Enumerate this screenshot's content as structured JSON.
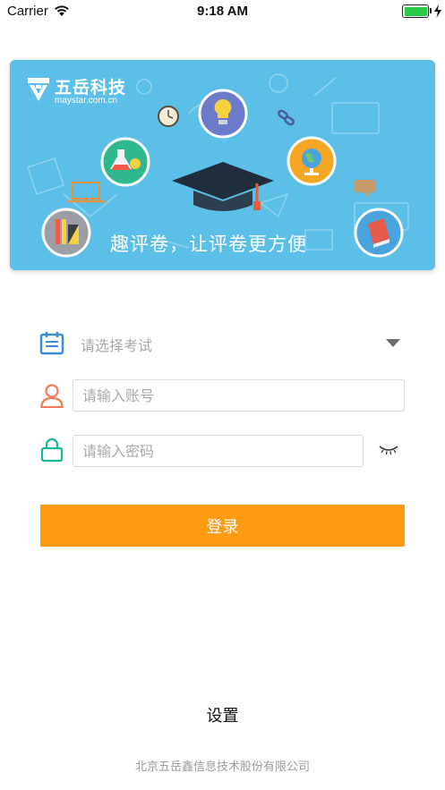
{
  "status_bar": {
    "carrier": "Carrier",
    "time": "9:18 AM",
    "battery_level": 1.0
  },
  "banner": {
    "logo_name": "五岳科技",
    "logo_url": "maystar.com.cn",
    "slogan": "趣评卷，让评卷更方便",
    "background_color": "#5bbfe8"
  },
  "form": {
    "exam_placeholder": "请选择考试",
    "account_placeholder": "请输入账号",
    "password_placeholder": "请输入密码",
    "login_label": "登录",
    "accent_color": "#ff9a13",
    "icons": [
      "calendar-icon",
      "user-icon",
      "lock-icon",
      "eye-closed-icon",
      "dropdown-arrow-icon"
    ]
  },
  "footer": {
    "settings_label": "设置",
    "company": "北京五岳鑫信息技术股份有限公司"
  }
}
